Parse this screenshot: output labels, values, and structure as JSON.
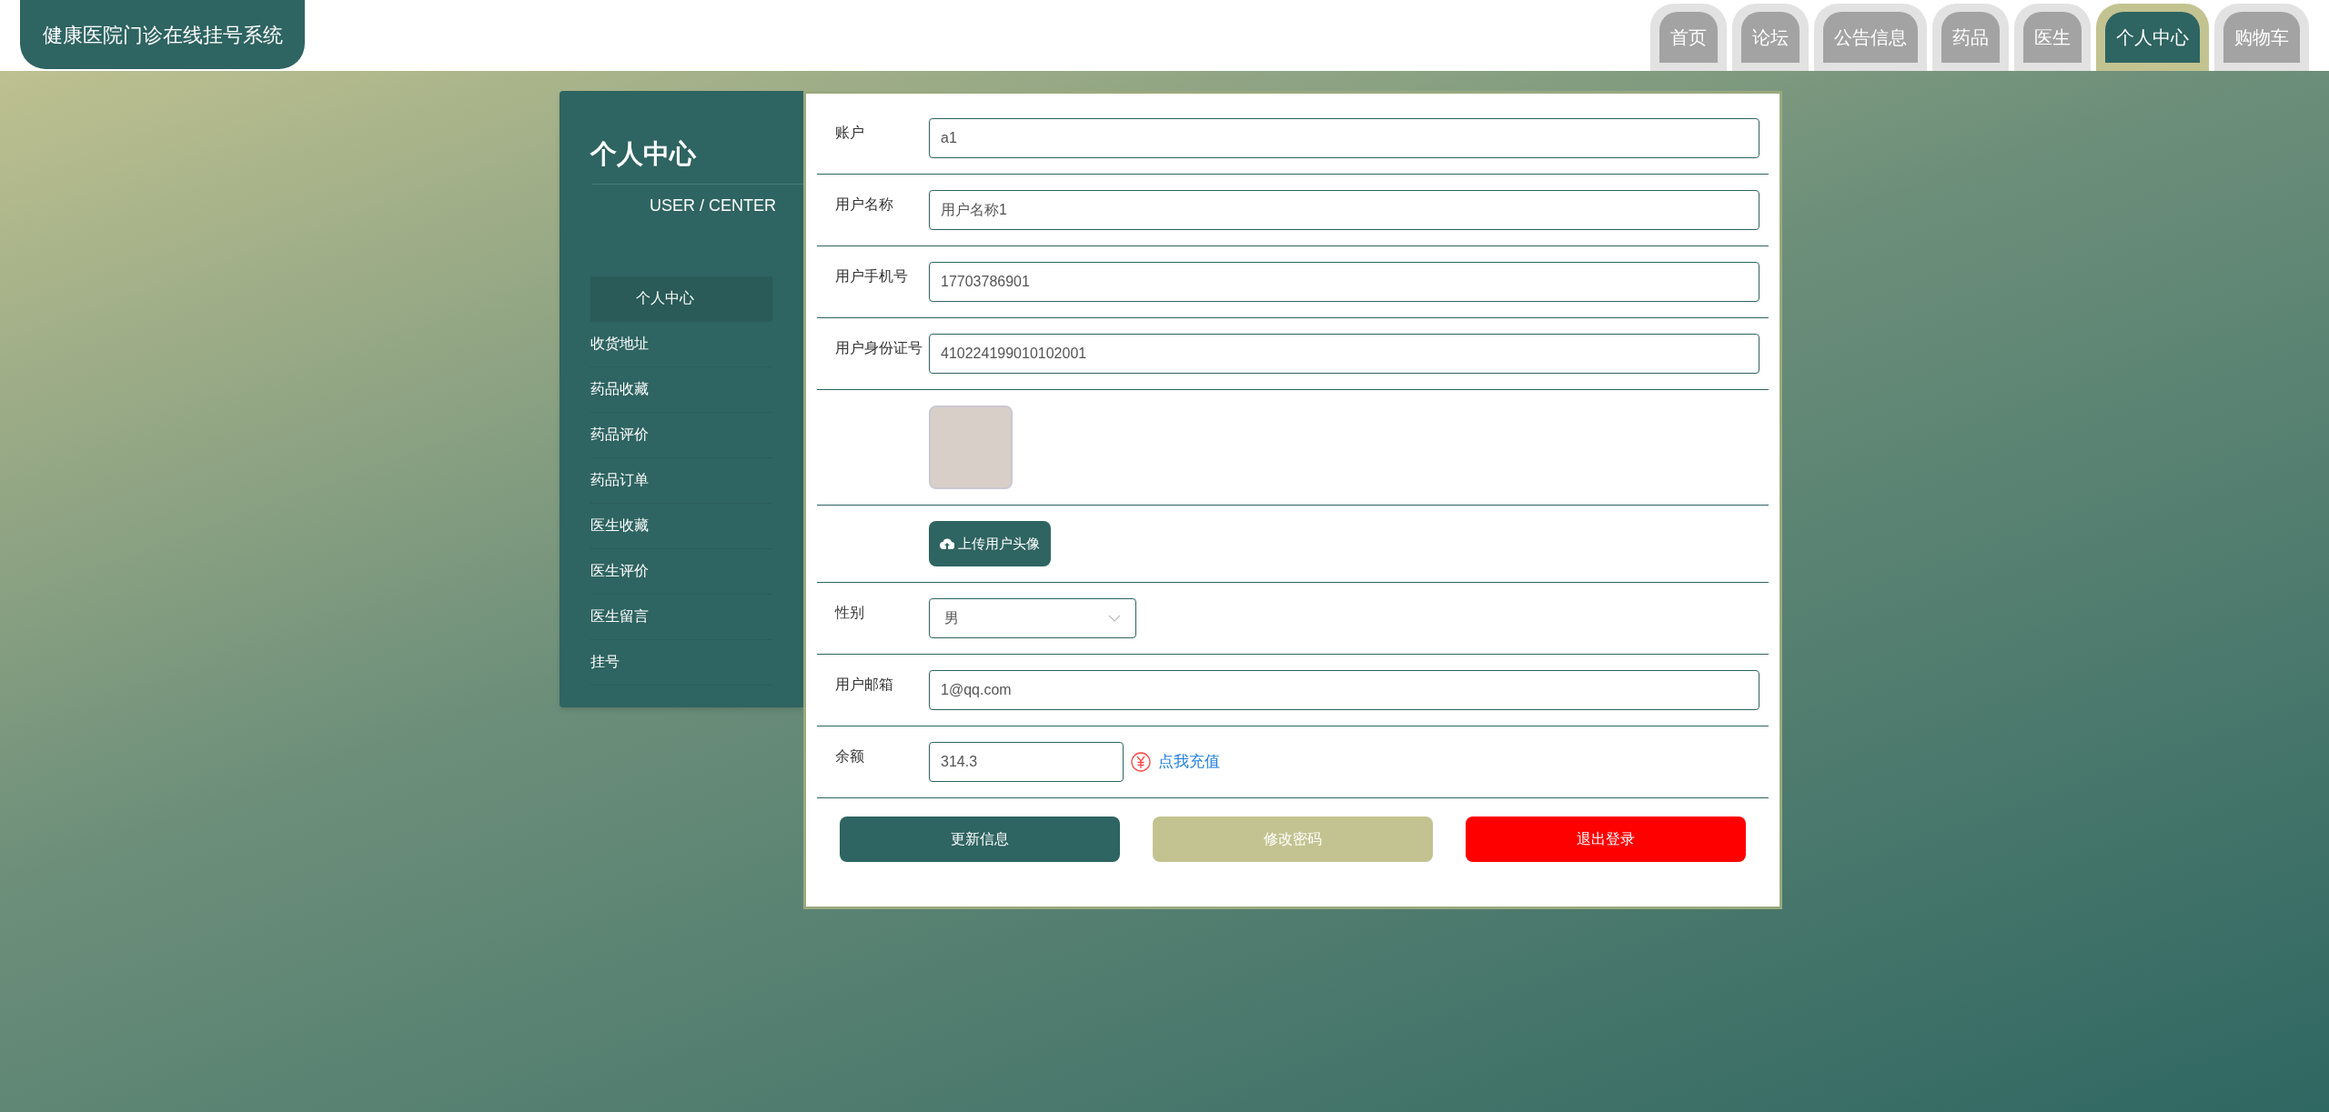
{
  "header": {
    "title": "健康医院门诊在线挂号系统",
    "nav": [
      {
        "label": "首页",
        "selected": false
      },
      {
        "label": "论坛",
        "selected": false
      },
      {
        "label": "公告信息",
        "selected": false
      },
      {
        "label": "药品",
        "selected": false
      },
      {
        "label": "医生",
        "selected": false
      },
      {
        "label": "个人中心",
        "selected": true
      },
      {
        "label": "购物车",
        "selected": false
      }
    ]
  },
  "sidebar": {
    "title": "个人中心",
    "subtitle": "USER / CENTER",
    "items": [
      {
        "label": "个人中心",
        "selected": true
      },
      {
        "label": "收货地址",
        "selected": false
      },
      {
        "label": "药品收藏",
        "selected": false
      },
      {
        "label": "药品评价",
        "selected": false
      },
      {
        "label": "药品订单",
        "selected": false
      },
      {
        "label": "医生收藏",
        "selected": false
      },
      {
        "label": "医生评价",
        "selected": false
      },
      {
        "label": "医生留言",
        "selected": false
      },
      {
        "label": "挂号",
        "selected": false
      }
    ]
  },
  "form": {
    "rows": [
      {
        "kind": "text",
        "label": "账户",
        "value": "a1"
      },
      {
        "kind": "text",
        "label": "用户名称",
        "value": "用户名称1"
      },
      {
        "kind": "text",
        "label": "用户手机号",
        "value": "17703786901"
      },
      {
        "kind": "text",
        "label": "用户身份证号",
        "value": "410224199010102001"
      },
      {
        "kind": "avatar"
      },
      {
        "kind": "upload",
        "button": "上传用户头像"
      },
      {
        "kind": "select",
        "label": "性别",
        "value": "男"
      },
      {
        "kind": "text",
        "label": "用户邮箱",
        "value": "1@qq.com"
      },
      {
        "kind": "balance",
        "label": "余额",
        "value": "314.3",
        "link": "点我充值"
      }
    ],
    "buttons": [
      {
        "kind": "primary",
        "label": "更新信息"
      },
      {
        "kind": "secondary",
        "label": "修改密码"
      },
      {
        "kind": "danger",
        "label": "退出登录"
      }
    ]
  }
}
